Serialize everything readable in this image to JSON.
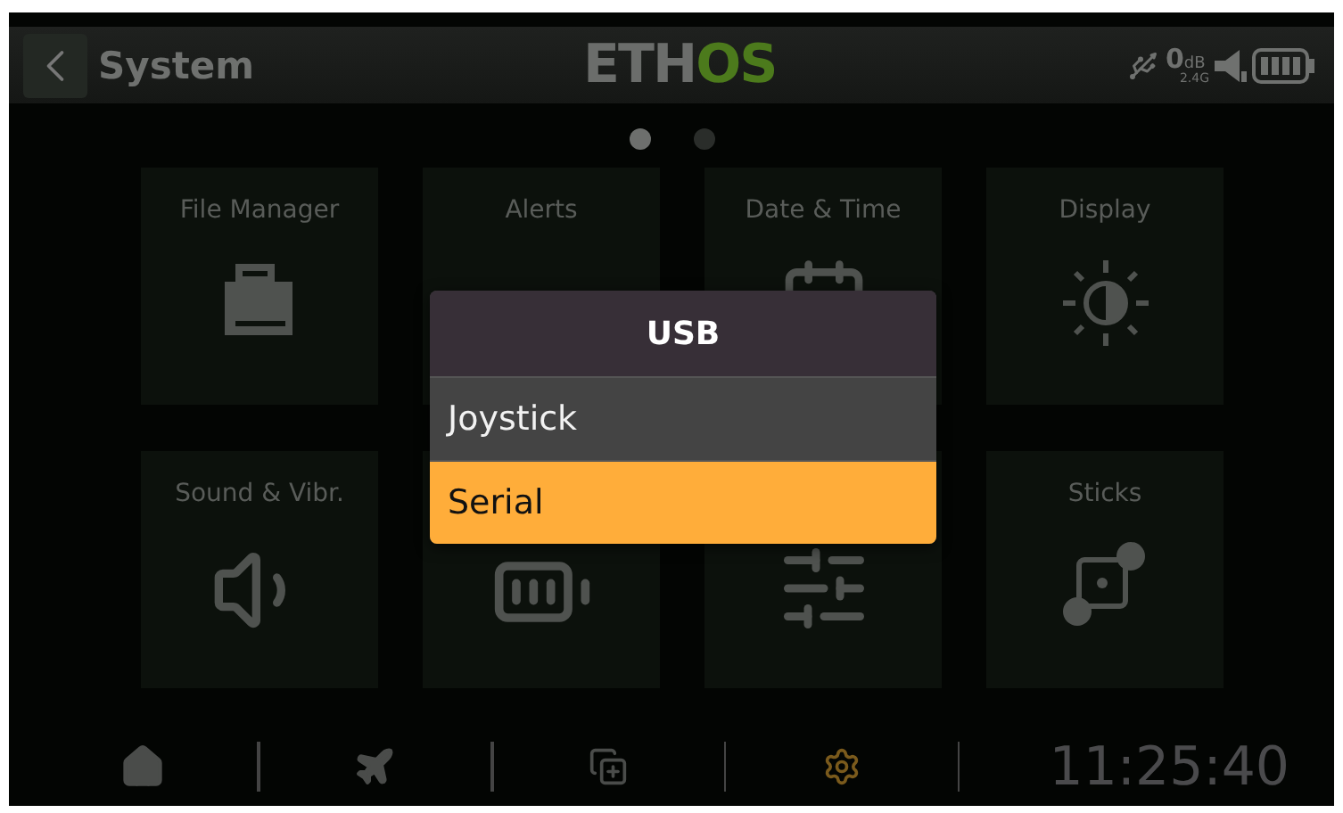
{
  "header": {
    "title": "System",
    "logo": {
      "light": "ETH",
      "accent": "OS"
    },
    "rf": {
      "value": "0",
      "unit": "dB",
      "band": "2.4G"
    }
  },
  "pages": [
    {
      "selected": true
    },
    {
      "selected": false
    }
  ],
  "tiles": [
    {
      "label": "File Manager",
      "kind": "files"
    },
    {
      "label": "Alerts"
    },
    {
      "label": "Date & Time",
      "kind": "calendar"
    },
    {
      "label": "Display",
      "kind": "display"
    },
    {
      "label": "Sound & Vibr.",
      "kind": "sound"
    },
    {
      "kind": "battery"
    },
    {
      "kind": "sliders"
    },
    {
      "label": "Sticks",
      "kind": "sticks"
    }
  ],
  "dialog": {
    "title": "USB",
    "options": [
      {
        "label": "Joystick",
        "selected": false
      },
      {
        "label": "Serial",
        "selected": true
      }
    ]
  },
  "nav": [
    {
      "kind": "home",
      "selected": false
    },
    {
      "kind": "plane",
      "selected": false
    },
    {
      "kind": "copy",
      "selected": false
    },
    {
      "kind": "gear",
      "selected": true
    }
  ],
  "clock": "11:25:40"
}
